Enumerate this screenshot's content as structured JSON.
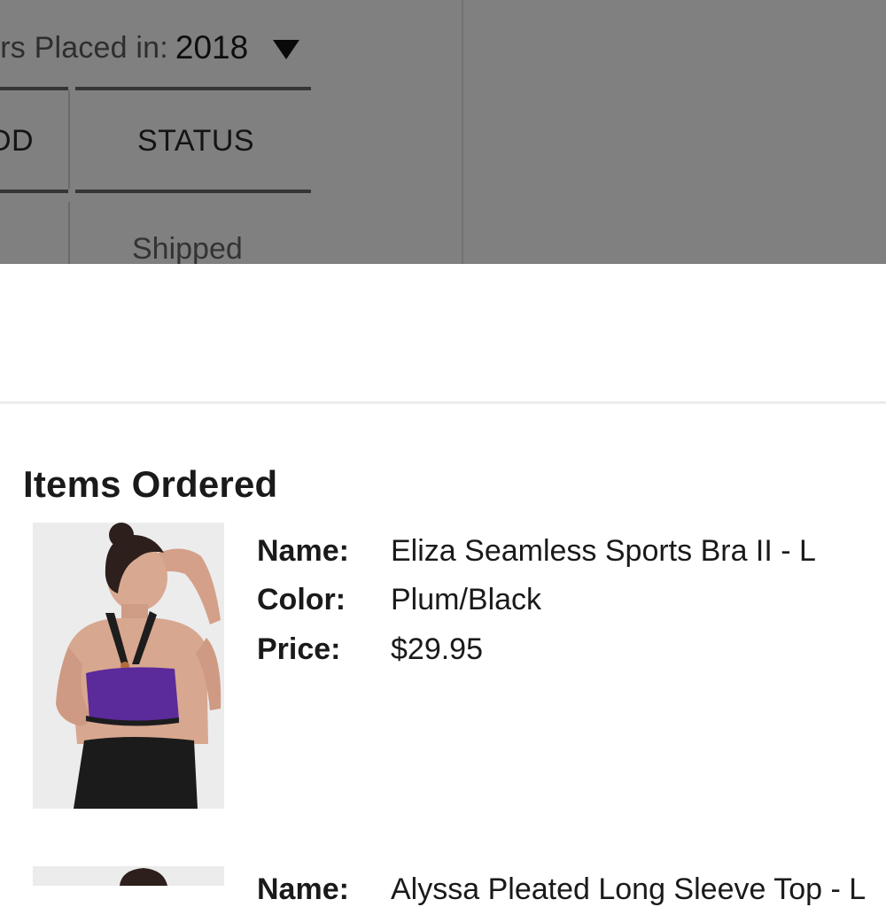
{
  "background_page": {
    "orders_filter": {
      "label": "ders Placed in:",
      "value": "2018",
      "icon": "caret-down-icon"
    },
    "table": {
      "headers": [
        "DD",
        "STATUS"
      ],
      "rows": [
        [
          "",
          "Shipped"
        ]
      ]
    }
  },
  "items_ordered": {
    "heading": "Items Ordered",
    "items": [
      {
        "name_label": "Name:",
        "name": "Eliza Seamless Sports Bra II - L",
        "color_label": "Color:",
        "color": "Plum/Black",
        "price_label": "Price:",
        "price": "$29.95"
      },
      {
        "name_label": "Name:",
        "name": "Alyssa Pleated Long Sleeve Top - L"
      }
    ]
  },
  "colors": {
    "overlay_gray": "#808080",
    "bra_purple": "#5b2a9b",
    "text_dark": "#1a1a1a"
  }
}
